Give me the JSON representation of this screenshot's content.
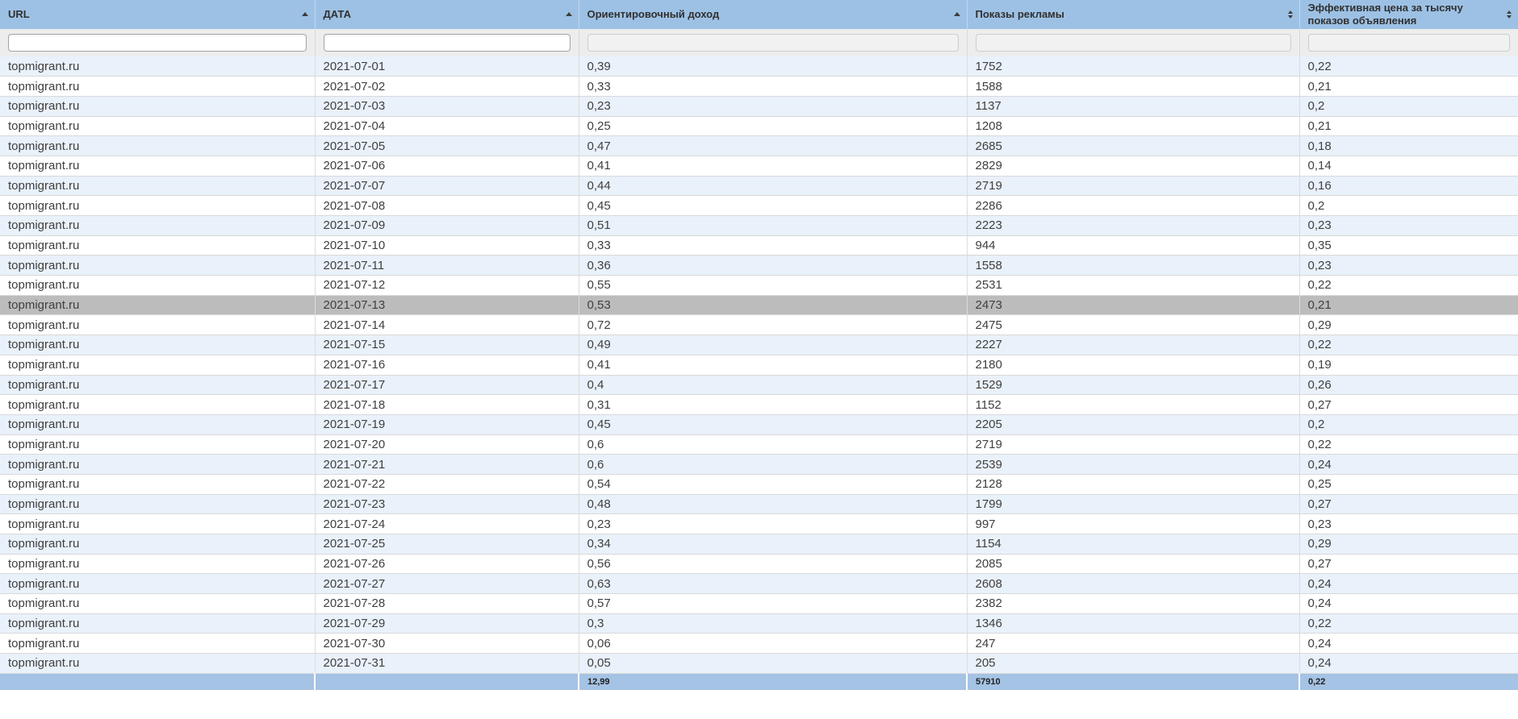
{
  "table": {
    "columns": [
      {
        "id": "url",
        "label": "URL",
        "sort": "asc",
        "filter_enabled": true
      },
      {
        "id": "date",
        "label": "ДАТА",
        "sort": "asc",
        "filter_enabled": true
      },
      {
        "id": "income",
        "label": "Ориентировочный доход",
        "sort": "asc",
        "filter_enabled": false
      },
      {
        "id": "impressions",
        "label": "Показы рекламы",
        "sort": "none",
        "filter_enabled": false
      },
      {
        "id": "cpm",
        "label": "Эффективная цена за тысячу показов объявления",
        "sort": "none",
        "filter_enabled": false
      }
    ],
    "filters": [
      {
        "value": "",
        "placeholder": ""
      },
      {
        "value": "",
        "placeholder": ""
      },
      {
        "value": "",
        "placeholder": ""
      },
      {
        "value": "",
        "placeholder": ""
      },
      {
        "value": "",
        "placeholder": ""
      }
    ],
    "rows": [
      [
        "topmigrant.ru",
        "2021-07-01",
        "0,39",
        "1752",
        "0,22"
      ],
      [
        "topmigrant.ru",
        "2021-07-02",
        "0,33",
        "1588",
        "0,21"
      ],
      [
        "topmigrant.ru",
        "2021-07-03",
        "0,23",
        "1137",
        "0,2"
      ],
      [
        "topmigrant.ru",
        "2021-07-04",
        "0,25",
        "1208",
        "0,21"
      ],
      [
        "topmigrant.ru",
        "2021-07-05",
        "0,47",
        "2685",
        "0,18"
      ],
      [
        "topmigrant.ru",
        "2021-07-06",
        "0,41",
        "2829",
        "0,14"
      ],
      [
        "topmigrant.ru",
        "2021-07-07",
        "0,44",
        "2719",
        "0,16"
      ],
      [
        "topmigrant.ru",
        "2021-07-08",
        "0,45",
        "2286",
        "0,2"
      ],
      [
        "topmigrant.ru",
        "2021-07-09",
        "0,51",
        "2223",
        "0,23"
      ],
      [
        "topmigrant.ru",
        "2021-07-10",
        "0,33",
        "944",
        "0,35"
      ],
      [
        "topmigrant.ru",
        "2021-07-11",
        "0,36",
        "1558",
        "0,23"
      ],
      [
        "topmigrant.ru",
        "2021-07-12",
        "0,55",
        "2531",
        "0,22"
      ],
      [
        "topmigrant.ru",
        "2021-07-13",
        "0,53",
        "2473",
        "0,21"
      ],
      [
        "topmigrant.ru",
        "2021-07-14",
        "0,72",
        "2475",
        "0,29"
      ],
      [
        "topmigrant.ru",
        "2021-07-15",
        "0,49",
        "2227",
        "0,22"
      ],
      [
        "topmigrant.ru",
        "2021-07-16",
        "0,41",
        "2180",
        "0,19"
      ],
      [
        "topmigrant.ru",
        "2021-07-17",
        "0,4",
        "1529",
        "0,26"
      ],
      [
        "topmigrant.ru",
        "2021-07-18",
        "0,31",
        "1152",
        "0,27"
      ],
      [
        "topmigrant.ru",
        "2021-07-19",
        "0,45",
        "2205",
        "0,2"
      ],
      [
        "topmigrant.ru",
        "2021-07-20",
        "0,6",
        "2719",
        "0,22"
      ],
      [
        "topmigrant.ru",
        "2021-07-21",
        "0,6",
        "2539",
        "0,24"
      ],
      [
        "topmigrant.ru",
        "2021-07-22",
        "0,54",
        "2128",
        "0,25"
      ],
      [
        "topmigrant.ru",
        "2021-07-23",
        "0,48",
        "1799",
        "0,27"
      ],
      [
        "topmigrant.ru",
        "2021-07-24",
        "0,23",
        "997",
        "0,23"
      ],
      [
        "topmigrant.ru",
        "2021-07-25",
        "0,34",
        "1154",
        "0,29"
      ],
      [
        "topmigrant.ru",
        "2021-07-26",
        "0,56",
        "2085",
        "0,27"
      ],
      [
        "topmigrant.ru",
        "2021-07-27",
        "0,63",
        "2608",
        "0,24"
      ],
      [
        "topmigrant.ru",
        "2021-07-28",
        "0,57",
        "2382",
        "0,24"
      ],
      [
        "topmigrant.ru",
        "2021-07-29",
        "0,3",
        "1346",
        "0,22"
      ],
      [
        "topmigrant.ru",
        "2021-07-30",
        "0,06",
        "247",
        "0,24"
      ],
      [
        "topmigrant.ru",
        "2021-07-31",
        "0,05",
        "205",
        "0,24"
      ]
    ],
    "highlighted_row_index": 12,
    "totals": [
      "",
      "",
      "12,99",
      "57910",
      "0,22"
    ]
  },
  "colors": {
    "header_bg": "#9dc1e4",
    "filter_bg": "#ededed",
    "row_odd": "#e9f1fa",
    "row_even": "#ffffff",
    "row_highlight": "#bcbcbc",
    "totals_bg": "#a5c3e4",
    "text": "#3f3f3f"
  },
  "icons": {
    "sort_ascending": "sort-asc-icon",
    "sort_unsorted": "sort-unsorted-icon"
  }
}
